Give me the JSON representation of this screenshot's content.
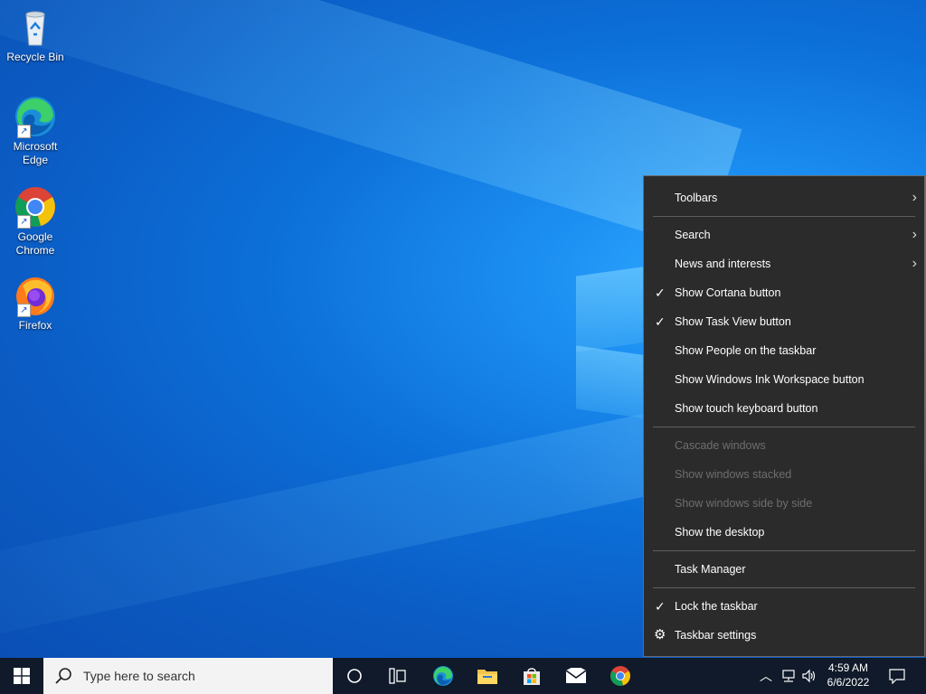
{
  "desktop": {
    "icons": [
      {
        "label": "Recycle Bin",
        "icon": "recycle-bin-icon"
      },
      {
        "label": "Microsoft Edge",
        "icon": "edge-icon"
      },
      {
        "label": "Google Chrome",
        "icon": "chrome-icon"
      },
      {
        "label": "Firefox",
        "icon": "firefox-icon"
      }
    ]
  },
  "context_menu": {
    "items": [
      {
        "label": "Toolbars",
        "submenu": true
      },
      {
        "label": "Search",
        "submenu": true
      },
      {
        "label": "News and interests",
        "submenu": true
      },
      {
        "label": "Show Cortana button",
        "checked": true
      },
      {
        "label": "Show Task View button",
        "checked": true
      },
      {
        "label": "Show People on the taskbar"
      },
      {
        "label": "Show Windows Ink Workspace button"
      },
      {
        "label": "Show touch keyboard button"
      },
      {
        "label": "Cascade windows",
        "disabled": true
      },
      {
        "label": "Show windows stacked",
        "disabled": true
      },
      {
        "label": "Show windows side by side",
        "disabled": true
      },
      {
        "label": "Show the desktop"
      },
      {
        "label": "Task Manager"
      },
      {
        "label": "Lock the taskbar",
        "checked": true
      },
      {
        "label": "Taskbar settings",
        "icon": "gear-icon"
      }
    ]
  },
  "taskbar": {
    "search_placeholder": "Type here to search",
    "time": "4:59 AM",
    "date": "6/6/2022",
    "pinned": [
      "cortana-icon",
      "task-view-icon",
      "edge-icon",
      "file-explorer-icon",
      "store-icon",
      "mail-icon",
      "chrome-icon"
    ]
  },
  "colors": {
    "menu_bg": "#2b2b2b",
    "taskbar_bg": "#101a2a",
    "desktop_accent": "#1c8ff2"
  }
}
